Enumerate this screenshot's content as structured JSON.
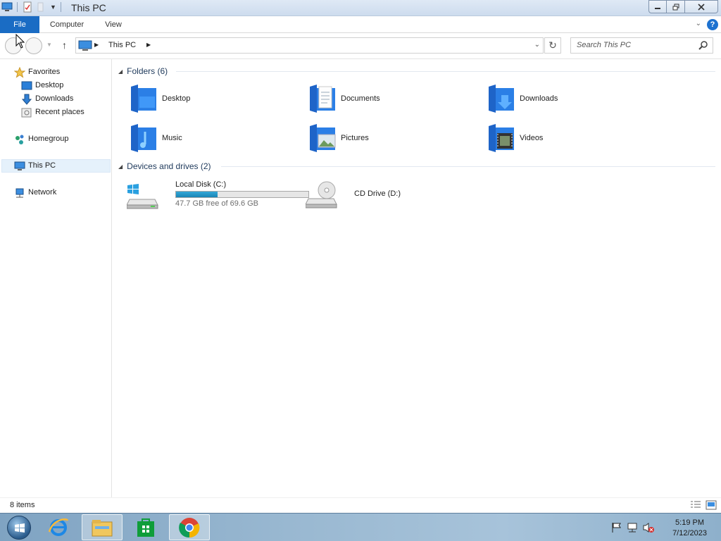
{
  "window": {
    "title": "This PC"
  },
  "ribbon": {
    "tabs": [
      "File",
      "Computer",
      "View"
    ]
  },
  "address": {
    "location": "This PC",
    "search_placeholder": "Search This PC"
  },
  "nav": {
    "favorites": "Favorites",
    "desktop": "Desktop",
    "downloads": "Downloads",
    "recent_places": "Recent places",
    "homegroup": "Homegroup",
    "this_pc": "This PC",
    "network": "Network"
  },
  "folders": {
    "header": "Folders (6)",
    "items": [
      "Desktop",
      "Documents",
      "Downloads",
      "Music",
      "Pictures",
      "Videos"
    ]
  },
  "devices": {
    "header": "Devices and drives (2)",
    "local_disk": {
      "name": "Local Disk (C:)",
      "free_text": "47.7 GB free of 69.6 GB",
      "used_fraction": 0.315
    },
    "cd_drive": {
      "name": "CD Drive (D:)"
    }
  },
  "status": {
    "items_count": "8 items"
  },
  "clock": {
    "time": "5:19 PM",
    "date": "7/12/2023"
  },
  "colors": {
    "accent": "#1a6cc4",
    "folder_blue": "#1e64c8",
    "drive_fill": "#2596c6"
  }
}
